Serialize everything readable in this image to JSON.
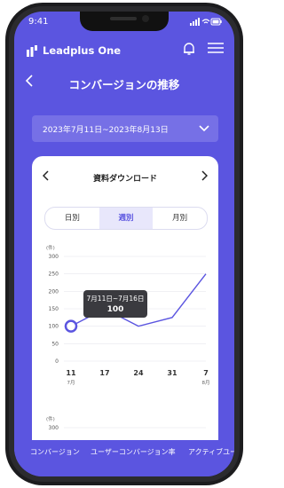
{
  "status": {
    "time": "9:41"
  },
  "app": {
    "logo_text": "Leadplus One"
  },
  "header": {
    "title": "コンバージョンの推移"
  },
  "date_range": {
    "text": "2023年7月11日~2023年8月13日"
  },
  "card": {
    "title": "資料ダウンロード",
    "segments": [
      "日別",
      "週別",
      "月別"
    ],
    "active_segment": "週別",
    "tooltip": {
      "range": "7月11日~7月16日",
      "value": "100"
    }
  },
  "chart_data": {
    "type": "line",
    "y_unit": "(件)",
    "y_ticks": [
      "300",
      "250",
      "200",
      "150",
      "100",
      "50",
      "0"
    ],
    "ylim": [
      0,
      300
    ],
    "x_labels": [
      {
        "day": "11",
        "month": "7月"
      },
      {
        "day": "17",
        "month": ""
      },
      {
        "day": "24",
        "month": ""
      },
      {
        "day": "31",
        "month": ""
      },
      {
        "day": "7",
        "month": "8月"
      }
    ],
    "series": [
      {
        "values": [
          100,
          150,
          100,
          125,
          250
        ]
      }
    ],
    "highlight_index": 0,
    "grid": true
  },
  "second_chart": {
    "y_unit": "(件)",
    "top_tick": "300"
  },
  "bottom_nav": [
    "コンバージョン",
    "ユーザーコンバージョン率",
    "アクティブユー"
  ],
  "colors": {
    "primary": "#5b55e0",
    "date_bar": "#7670e6",
    "tooltip": "#3a3a3f"
  }
}
